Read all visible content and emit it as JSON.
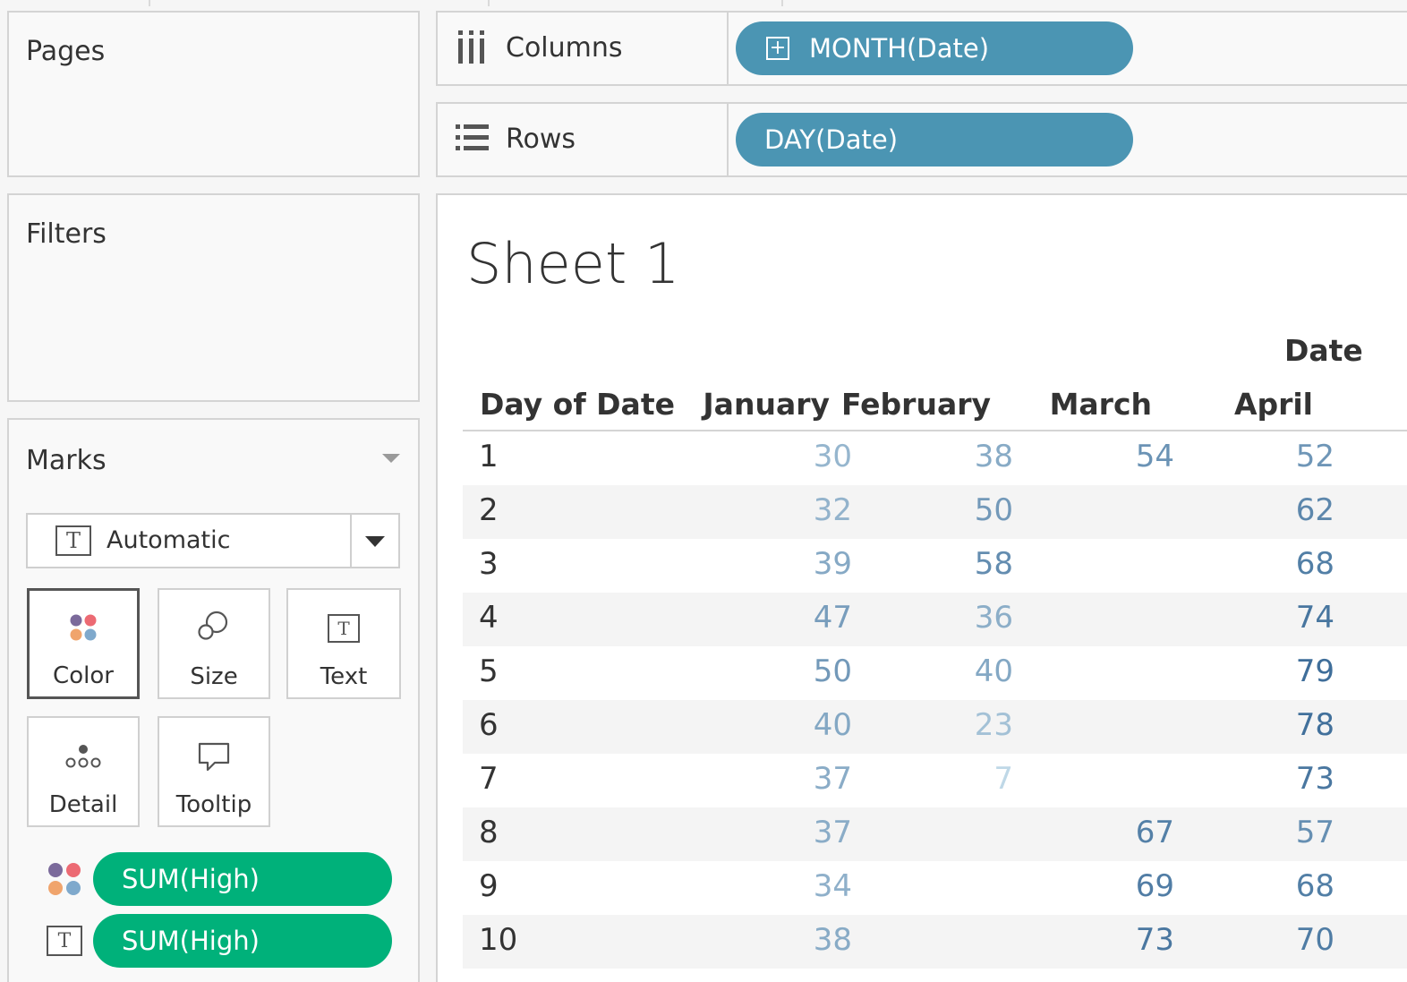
{
  "cards": {
    "pages_title": "Pages",
    "filters_title": "Filters",
    "marks_title": "Marks"
  },
  "marks": {
    "mark_type": "Automatic",
    "buttons": {
      "color": "Color",
      "size": "Size",
      "text": "Text",
      "detail": "Detail",
      "tooltip": "Tooltip"
    },
    "fields": [
      {
        "encoding": "color",
        "label": "SUM(High)"
      },
      {
        "encoding": "text",
        "label": "SUM(High)"
      }
    ]
  },
  "shelves": {
    "columns_label": "Columns",
    "columns_pill": "MONTH(Date)",
    "rows_label": "Rows",
    "rows_pill": "DAY(Date)"
  },
  "view": {
    "sheet_title": "Sheet 1",
    "column_field_title": "Date",
    "row_header": "Day of Date",
    "months": [
      "January",
      "February",
      "March",
      "April"
    ],
    "rows": [
      {
        "day": "1",
        "values": [
          "30",
          "38",
          "54",
          "52"
        ]
      },
      {
        "day": "2",
        "values": [
          "32",
          "50",
          "",
          "62"
        ]
      },
      {
        "day": "3",
        "values": [
          "39",
          "58",
          "",
          "68"
        ]
      },
      {
        "day": "4",
        "values": [
          "47",
          "36",
          "",
          "74"
        ]
      },
      {
        "day": "5",
        "values": [
          "50",
          "40",
          "",
          "79"
        ]
      },
      {
        "day": "6",
        "values": [
          "40",
          "23",
          "",
          "78"
        ]
      },
      {
        "day": "7",
        "values": [
          "37",
          "7",
          "",
          "73"
        ]
      },
      {
        "day": "8",
        "values": [
          "37",
          "",
          "67",
          "57"
        ]
      },
      {
        "day": "9",
        "values": [
          "34",
          "",
          "69",
          "68"
        ]
      },
      {
        "day": "10",
        "values": [
          "38",
          "",
          "73",
          "70"
        ]
      }
    ]
  },
  "colors": {
    "pill_blue": "#4b95b3",
    "pill_green": "#00b17a",
    "value_low": "#c3dbe9",
    "value_high": "#3d6d99"
  }
}
